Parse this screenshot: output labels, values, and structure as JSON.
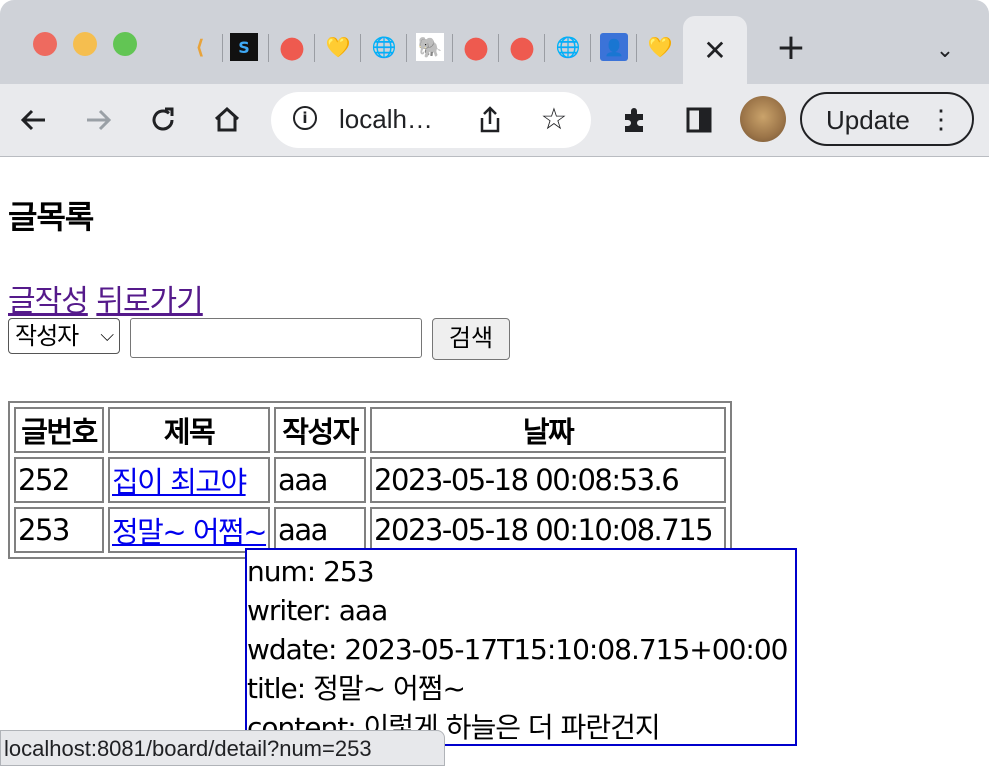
{
  "browser": {
    "tabs": [
      {
        "icon": "leetcode-icon",
        "glyph": "⟨"
      },
      {
        "icon": "shell-icon",
        "glyph": "S"
      },
      {
        "icon": "coupang-icon",
        "glyph": "●"
      },
      {
        "icon": "heart-icon",
        "glyph": "💛"
      },
      {
        "icon": "globe-icon",
        "glyph": "🌐"
      },
      {
        "icon": "elephant-icon",
        "glyph": "🐘"
      },
      {
        "icon": "coupang-icon",
        "glyph": "●"
      },
      {
        "icon": "coupang-icon",
        "glyph": "●"
      },
      {
        "icon": "globe-icon",
        "glyph": "🌐"
      },
      {
        "icon": "contact-icon",
        "glyph": "👤"
      },
      {
        "icon": "heart-icon",
        "glyph": "💛"
      }
    ],
    "active_tab_close": "✕",
    "new_tab": "+",
    "tab_menu": "⌄",
    "url": "localh…",
    "update_label": "Update",
    "status_url": "localhost:8081/board/detail?num=253"
  },
  "page": {
    "title": "글목록",
    "link_write": "글작성",
    "link_back": "뒤로가기",
    "search": {
      "selected_option": "작성자",
      "input_value": "",
      "button_label": "검색"
    },
    "table": {
      "headers": [
        "글번호",
        "제목",
        "작성자",
        "날짜"
      ],
      "rows": [
        {
          "num": "252",
          "title": "집이 최고야",
          "writer": "aaa",
          "date": "2023-05-18 00:08:53.6"
        },
        {
          "num": "253",
          "title": "정말~ 어쩜~",
          "writer": "aaa",
          "date": "2023-05-18 00:10:08.715"
        }
      ]
    },
    "tooltip": {
      "line1": "num: 253",
      "line2": "writer: aaa",
      "line3": "wdate: 2023-05-17T15:10:08.715+00:00",
      "line4": "title: 정말~ 어쩜~",
      "line5": "content: 이렇게 하늘은 더 파란건지"
    }
  },
  "colors": {
    "link_visited": "#551a8b",
    "link": "#0000ee",
    "tooltip_border": "#0000cc"
  }
}
